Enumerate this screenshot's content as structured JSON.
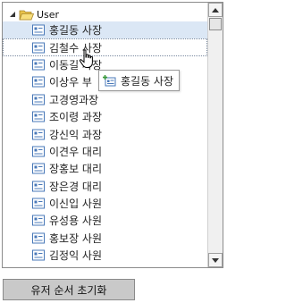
{
  "tree": {
    "root": {
      "label": "User",
      "icon": "folder-open-icon",
      "expanded": true
    },
    "selected_index": 0,
    "items": [
      {
        "label": "홍길동 사장"
      },
      {
        "label": "김철수 사장"
      },
      {
        "label": "이동길 사장"
      },
      {
        "label": "이상우 부"
      },
      {
        "label": "고경영과장"
      },
      {
        "label": "조이령 과장"
      },
      {
        "label": "강신익 과장"
      },
      {
        "label": "이견우 대리"
      },
      {
        "label": "장홍보 대리"
      },
      {
        "label": "장은경 대리"
      },
      {
        "label": "이신입 사원"
      },
      {
        "label": "유성용 사원"
      },
      {
        "label": "홍보장 사원"
      },
      {
        "label": "김정익 사원"
      },
      {
        "label": "김순이 사원"
      },
      {
        "label": "김영희 사원"
      }
    ]
  },
  "drag_ghost": {
    "label": "홍길동 사장",
    "icon": "user-card-add-icon"
  },
  "reset_button": {
    "label": "유저 순서 초기화"
  },
  "colors": {
    "selected_row": "#dbe7f5",
    "icon_blue": "#4a79b8",
    "button_bg": "#c9c9c9"
  }
}
